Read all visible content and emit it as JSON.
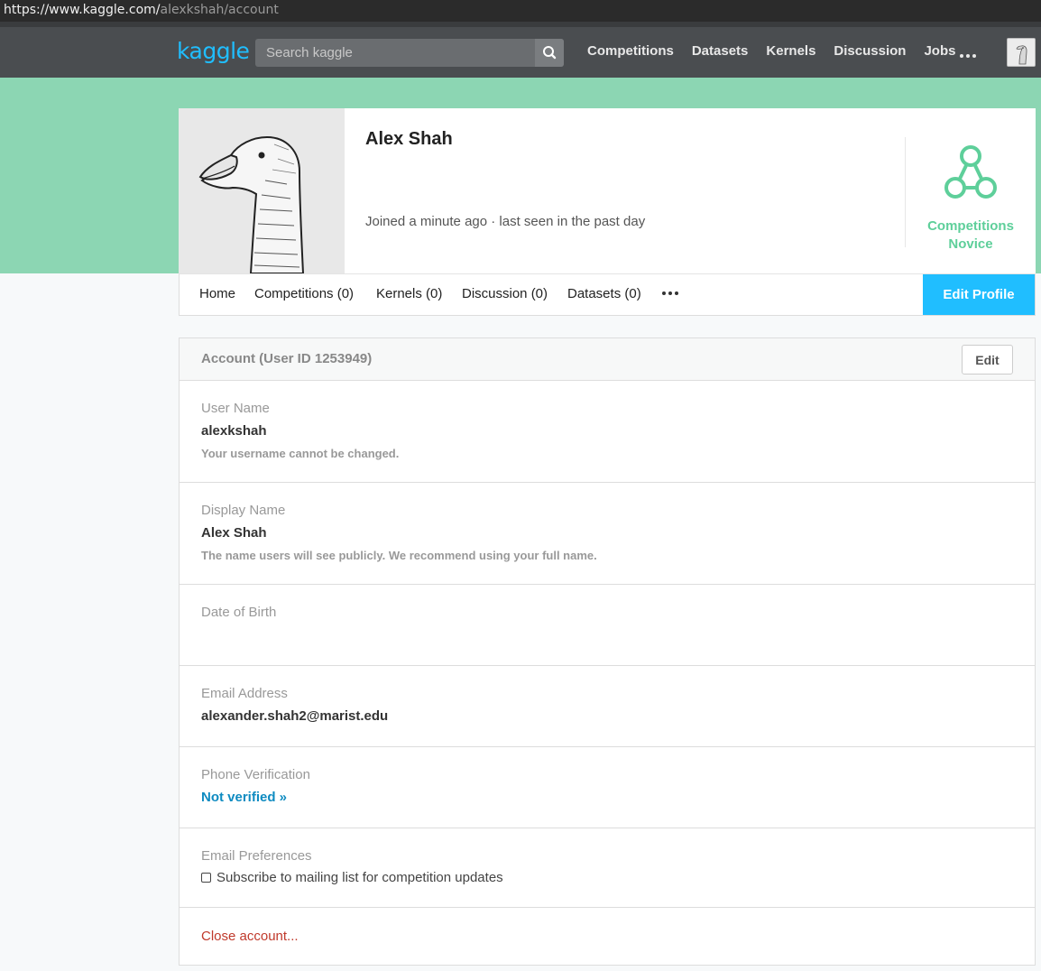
{
  "browser": {
    "url_scheme": "https://www.kaggle.com/",
    "url_path": "alexkshah/account"
  },
  "nav": {
    "logo": "kaggle",
    "search_placeholder": "Search kaggle",
    "links": [
      "Competitions",
      "Datasets",
      "Kernels",
      "Discussion",
      "Jobs"
    ],
    "more": "•••"
  },
  "profile": {
    "name": "Alex Shah",
    "joined": "Joined a minute ago · last seen in the past day",
    "tier_line1": "Competitions",
    "tier_line2": "Novice",
    "tier_color": "#5ecf9a"
  },
  "tabs": {
    "home": "Home",
    "competitions": "Competitions (0)",
    "kernels": "Kernels (0)",
    "discussion": "Discussion (0)",
    "datasets": "Datasets (0)",
    "more": "•••",
    "edit_profile": "Edit Profile"
  },
  "account": {
    "title": "Account (User ID 1253949)",
    "edit": "Edit",
    "username_label": "User Name",
    "username_value": "alexkshah",
    "username_hint": "Your username cannot be changed.",
    "display_label": "Display Name",
    "display_value": "Alex Shah",
    "display_hint": "The name users will see publicly. We recommend using your full name.",
    "dob_label": "Date of Birth",
    "email_label": "Email Address",
    "email_value": "alexander.shah2@marist.edu",
    "phone_label": "Phone Verification",
    "phone_link": "Not verified »",
    "prefs_label": "Email Preferences",
    "prefs_option": "Subscribe to mailing list for competition updates",
    "prefs_checked": false,
    "close": "Close account..."
  },
  "colors": {
    "accent": "#20beff",
    "band": "#8cd6b3",
    "nav_bg": "#4a4d50",
    "danger": "#c0392b",
    "link": "#0e8bc1"
  }
}
